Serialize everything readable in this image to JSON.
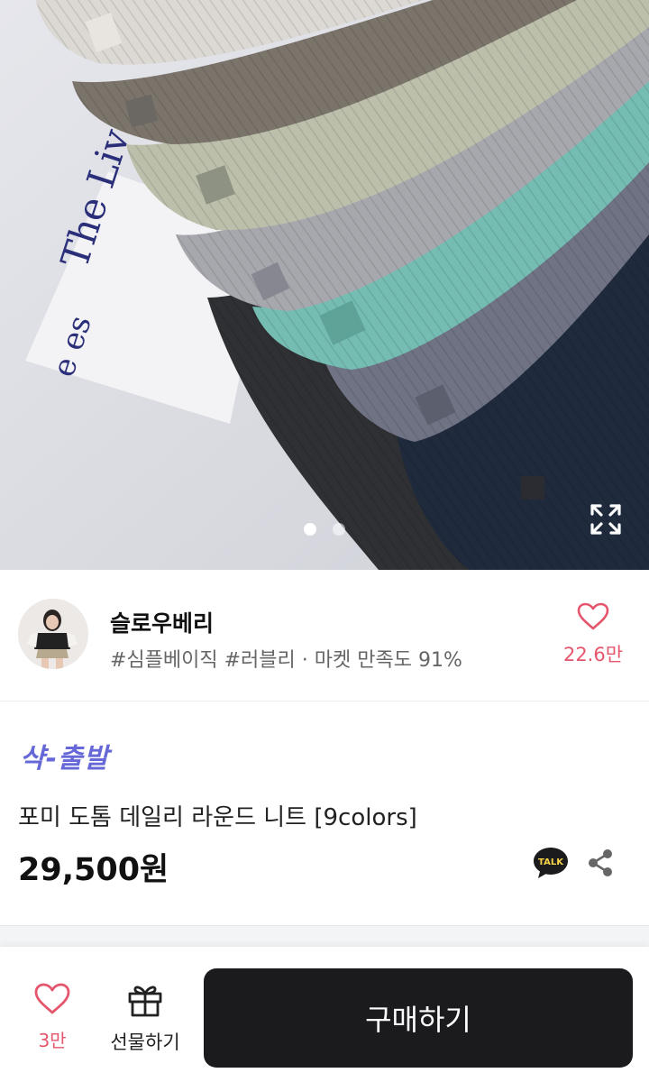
{
  "hero": {
    "book_text": "The Live",
    "book_text_2": "e es",
    "page_dots": {
      "count": 2,
      "active": 1
    }
  },
  "seller": {
    "name": "슬로우베리",
    "tags": "#심플베이직 #러블리 · 마켓 만족도 91%",
    "likes": "22.6만"
  },
  "product": {
    "badge": "샥-출발",
    "title": "포미 도톰 데일리 라운드 니트 [9colors]",
    "price": "29,500원",
    "talk_label": "TALK"
  },
  "bottom_bar": {
    "like_count": "3만",
    "gift_label": "선물하기",
    "buy_label": "구매하기"
  },
  "colors": {
    "accent_pink": "#e5566c",
    "badge_purple": "#6568d6",
    "buy_button": "#1b1b1e"
  },
  "icons": [
    "expand-icon",
    "heart-icon",
    "talk-icon",
    "share-icon",
    "gift-icon"
  ]
}
